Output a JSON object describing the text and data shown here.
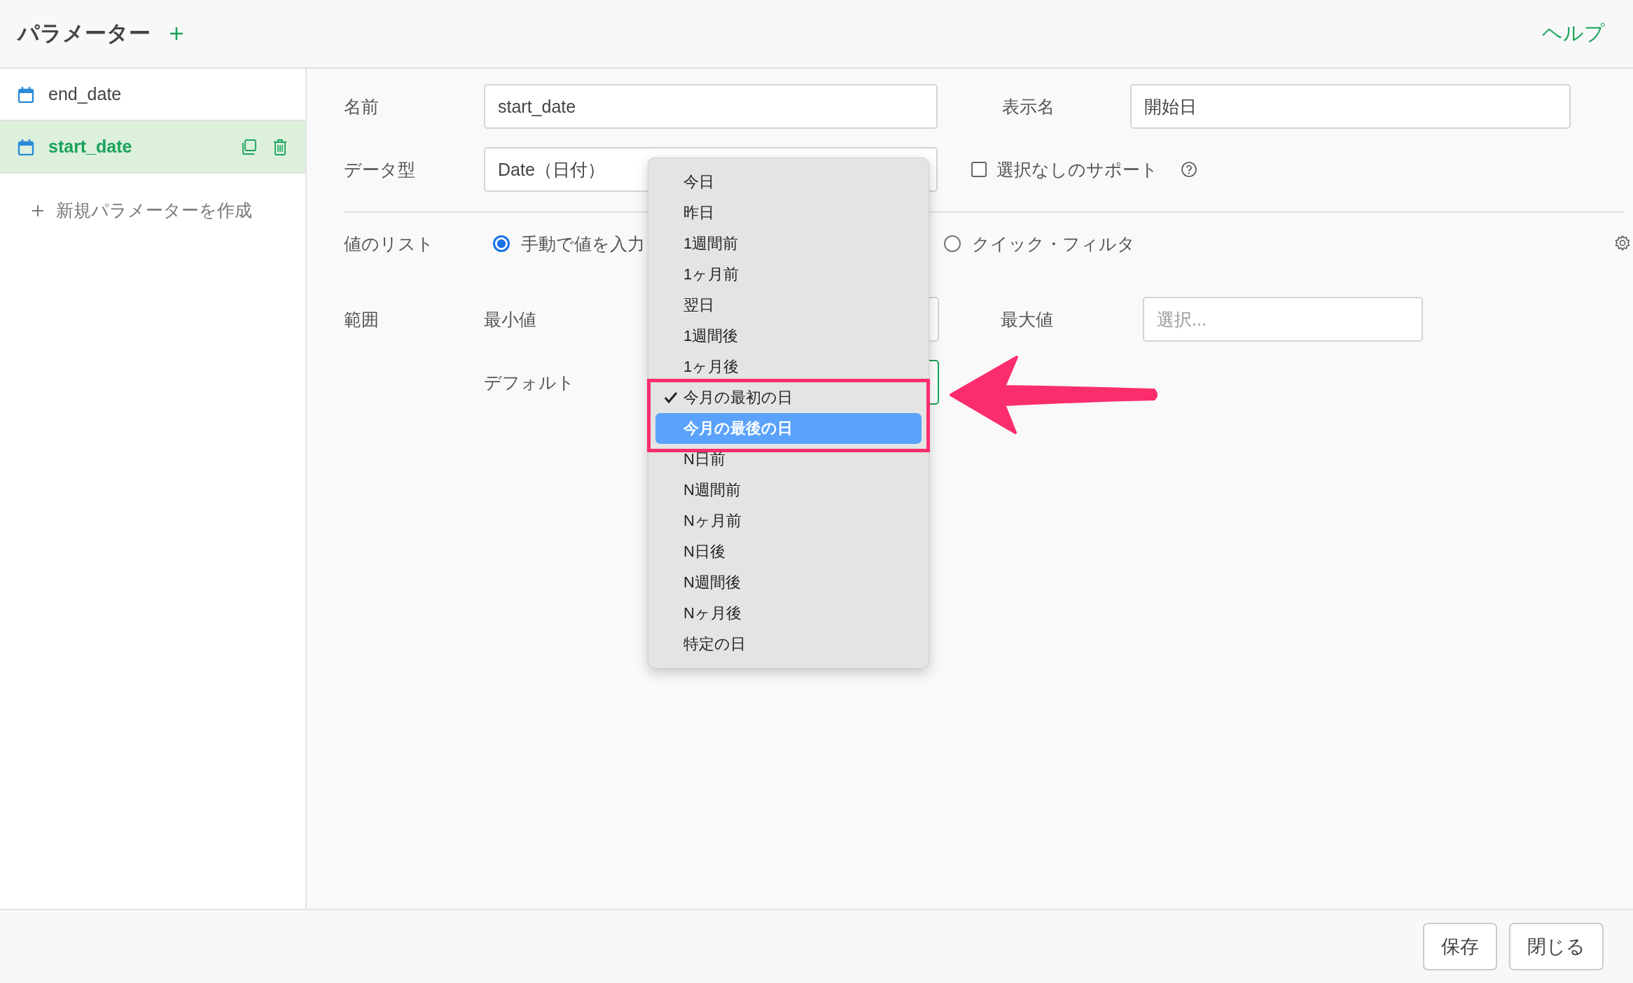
{
  "header": {
    "title": "パラメーター",
    "help_link": "ヘルプ"
  },
  "sidebar": {
    "items": [
      {
        "name": "end_date",
        "selected": false
      },
      {
        "name": "start_date",
        "selected": true
      }
    ],
    "create_link": "新規パラメーターを作成"
  },
  "form": {
    "name_label": "名前",
    "name_value": "start_date",
    "display_label": "表示名",
    "display_value": "開始日",
    "type_label": "データ型",
    "type_value": "Date（日付）",
    "support_none": {
      "label": "選択なしのサポート",
      "checked": false
    },
    "values_label": "値のリスト",
    "value_options": [
      {
        "label": "手動で値を入力",
        "selected": true
      },
      {
        "label": "クイック・フィルタ",
        "selected": false
      }
    ],
    "range_label": "範囲",
    "min_label": "最小値",
    "max_label": "最大値",
    "max_placeholder": "選択...",
    "default_label": "デフォルト"
  },
  "dropdown": {
    "items": [
      {
        "label": "今日",
        "checked": false,
        "highlighted": false
      },
      {
        "label": "昨日",
        "checked": false,
        "highlighted": false
      },
      {
        "label": "1週間前",
        "checked": false,
        "highlighted": false
      },
      {
        "label": "1ヶ月前",
        "checked": false,
        "highlighted": false
      },
      {
        "label": "翌日",
        "checked": false,
        "highlighted": false
      },
      {
        "label": "1週間後",
        "checked": false,
        "highlighted": false
      },
      {
        "label": "1ヶ月後",
        "checked": false,
        "highlighted": false
      },
      {
        "label": "今月の最初の日",
        "checked": true,
        "highlighted": false
      },
      {
        "label": "今月の最後の日",
        "checked": false,
        "highlighted": true
      },
      {
        "label": "N日前",
        "checked": false,
        "highlighted": false
      },
      {
        "label": "N週間前",
        "checked": false,
        "highlighted": false
      },
      {
        "label": "Nヶ月前",
        "checked": false,
        "highlighted": false
      },
      {
        "label": "N日後",
        "checked": false,
        "highlighted": false
      },
      {
        "label": "N週間後",
        "checked": false,
        "highlighted": false
      },
      {
        "label": "Nヶ月後",
        "checked": false,
        "highlighted": false
      },
      {
        "label": "特定の日",
        "checked": false,
        "highlighted": false
      }
    ]
  },
  "footer": {
    "buttons": [
      "保存",
      "閉じる"
    ]
  }
}
